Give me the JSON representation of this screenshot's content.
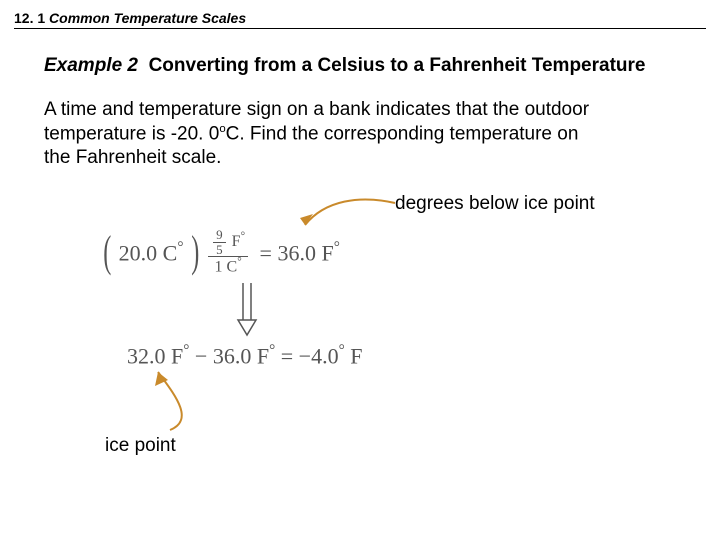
{
  "section": {
    "number": "12. 1",
    "title": "Common Temperature Scales"
  },
  "example": {
    "label": "Example 2",
    "title": "Converting from a Celsius to a Fahrenheit Temperature"
  },
  "body": {
    "line1": "A time and temperature sign on a bank indicates that the outdoor",
    "line2a": "temperature is -20. 0",
    "line2sup": "o",
    "line2b": "C.  Find the corresponding temperature on",
    "line3": "the Fahrenheit scale."
  },
  "annot": {
    "below": "degrees below ice point",
    "ice": "ice point"
  },
  "eq1": {
    "value": "20.0 C",
    "frac_top_num": "9",
    "frac_top_unit": "F",
    "frac_bot_num": "5",
    "frac_bot_denom": "1 C",
    "rhs": "= 36.0 F"
  },
  "eq2": {
    "a": "32.0 F",
    "op": "−",
    "b": "36.0 F",
    "eq": "=",
    "c": "−4.0",
    "unit": "F"
  }
}
